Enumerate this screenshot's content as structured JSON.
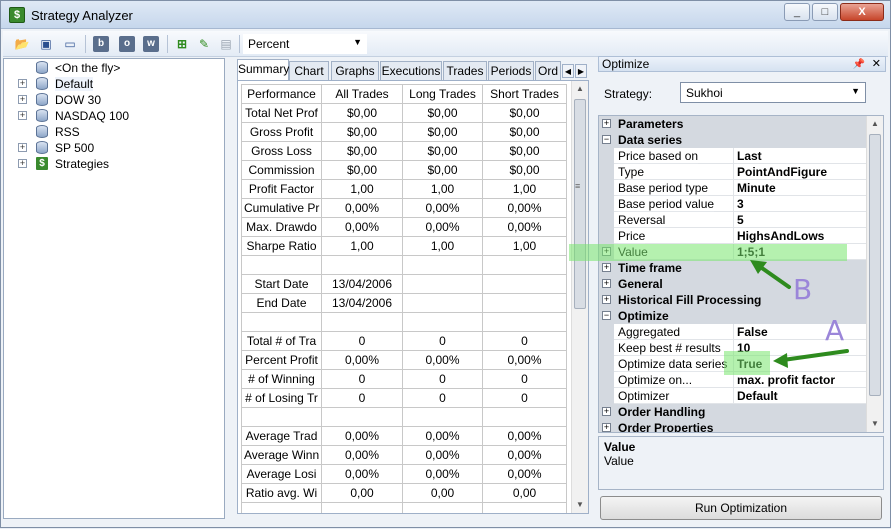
{
  "window": {
    "title": "Strategy Analyzer",
    "controls": [
      "_",
      "□",
      "X"
    ]
  },
  "toolbar": {
    "display_unit": "Percent"
  },
  "tree": {
    "items": [
      {
        "label": "<On the fly>",
        "icon": "database-icon",
        "expandable": false
      },
      {
        "label": "Default",
        "icon": "database-icon",
        "expandable": true
      },
      {
        "label": "DOW 30",
        "icon": "database-icon",
        "expandable": true
      },
      {
        "label": "NASDAQ 100",
        "icon": "database-icon",
        "expandable": true
      },
      {
        "label": "RSS",
        "icon": "database-icon",
        "expandable": false
      },
      {
        "label": "SP 500",
        "icon": "database-icon",
        "expandable": true
      },
      {
        "label": "Strategies",
        "icon": "dollar-icon",
        "expandable": true
      }
    ]
  },
  "center": {
    "tabs": [
      "Summary",
      "Chart",
      "Graphs",
      "Executions",
      "Trades",
      "Periods",
      "Ord"
    ],
    "active_tab": "Summary",
    "columns": [
      "Performance",
      "All Trades",
      "Long Trades",
      "Short Trades"
    ],
    "rows": [
      [
        "Total Net Prof",
        "$0,00",
        "$0,00",
        "$0,00"
      ],
      [
        "Gross Profit",
        "$0,00",
        "$0,00",
        "$0,00"
      ],
      [
        "Gross Loss",
        "$0,00",
        "$0,00",
        "$0,00"
      ],
      [
        "Commission",
        "$0,00",
        "$0,00",
        "$0,00"
      ],
      [
        "Profit Factor",
        "1,00",
        "1,00",
        "1,00"
      ],
      [
        "Cumulative Pr",
        "0,00%",
        "0,00%",
        "0,00%"
      ],
      [
        "Max. Drawdo",
        "0,00%",
        "0,00%",
        "0,00%"
      ],
      [
        "Sharpe Ratio",
        "1,00",
        "1,00",
        "1,00"
      ],
      [
        "",
        "",
        "",
        ""
      ],
      [
        "Start Date",
        "13/04/2006",
        "",
        ""
      ],
      [
        "End Date",
        "13/04/2006",
        "",
        ""
      ],
      [
        "",
        "",
        "",
        ""
      ],
      [
        "Total # of Tra",
        "0",
        "0",
        "0"
      ],
      [
        "Percent Profit",
        "0,00%",
        "0,00%",
        "0,00%"
      ],
      [
        "# of Winning",
        "0",
        "0",
        "0"
      ],
      [
        "# of Losing Tr",
        "0",
        "0",
        "0"
      ],
      [
        "",
        "",
        "",
        ""
      ],
      [
        "Average Trad",
        "0,00%",
        "0,00%",
        "0,00%"
      ],
      [
        "Average Winn",
        "0,00%",
        "0,00%",
        "0,00%"
      ],
      [
        "Average Losi",
        "0,00%",
        "0,00%",
        "0,00%"
      ],
      [
        "Ratio avg. Wi",
        "0,00",
        "0,00",
        "0,00"
      ],
      [
        "",
        "",
        "",
        ""
      ]
    ]
  },
  "optimize": {
    "title": "Optimize",
    "strategy_label": "Strategy:",
    "strategy_value": "Sukhoi",
    "properties": [
      {
        "type": "category",
        "name": "Parameters",
        "expanded": false
      },
      {
        "type": "category",
        "name": "Data series",
        "expanded": true
      },
      {
        "type": "item",
        "name": "Price based on",
        "value": "Last"
      },
      {
        "type": "item",
        "name": "Type",
        "value": "PointAndFigure"
      },
      {
        "type": "item",
        "name": "Base period type",
        "value": "Minute"
      },
      {
        "type": "item",
        "name": "Base period value",
        "value": "3"
      },
      {
        "type": "item",
        "name": "Reversal",
        "value": "5"
      },
      {
        "type": "item",
        "name": "Price",
        "value": "HighsAndLows"
      },
      {
        "type": "item",
        "name": "Value",
        "value": "1;5;1",
        "expandable": true
      },
      {
        "type": "category",
        "name": "Time frame",
        "expanded": false
      },
      {
        "type": "category",
        "name": "General",
        "expanded": false
      },
      {
        "type": "category",
        "name": "Historical Fill Processing",
        "expanded": false
      },
      {
        "type": "category",
        "name": "Optimize",
        "expanded": true
      },
      {
        "type": "item",
        "name": "Aggregated",
        "value": "False"
      },
      {
        "type": "item",
        "name": "Keep best # results",
        "value": "10"
      },
      {
        "type": "item",
        "name": "Optimize data series",
        "value": "True"
      },
      {
        "type": "item",
        "name": "Optimize on...",
        "value": "max. profit factor"
      },
      {
        "type": "item",
        "name": "Optimizer",
        "value": "Default"
      },
      {
        "type": "category",
        "name": "Order Handling",
        "expanded": false
      },
      {
        "type": "category",
        "name": "Order Properties",
        "expanded": false
      }
    ],
    "description_title": "Value",
    "description_text": "Value",
    "run_button": "Run Optimization"
  },
  "annotations": {
    "label_a": "A",
    "label_b": "B",
    "highlight_color": "#78e66e",
    "arrow_color": "#2e8b1e",
    "letter_color": "#9b86d9"
  }
}
